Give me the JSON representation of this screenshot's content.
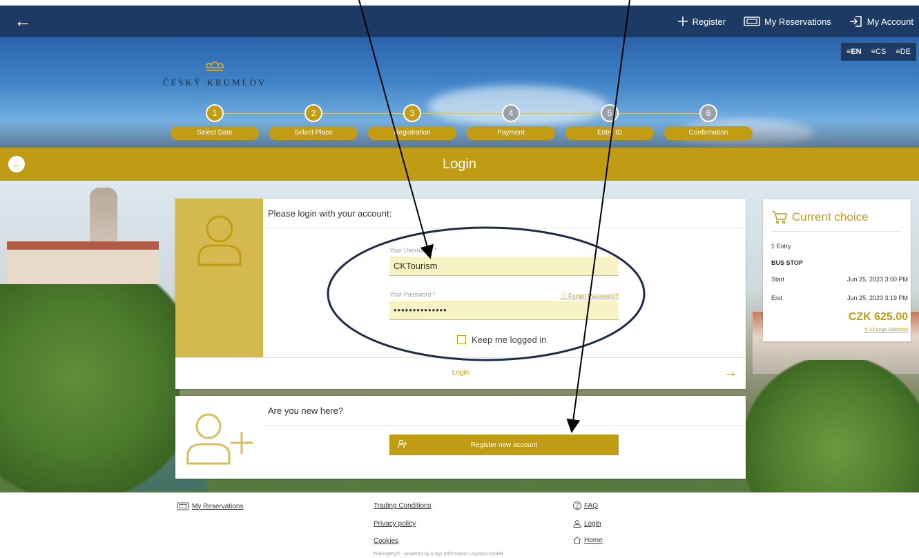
{
  "topbar": {
    "nav": [
      {
        "label": "Register",
        "icon": "plus-icon"
      },
      {
        "label": "My Reservations",
        "icon": "ticket-icon"
      },
      {
        "label": "My Account",
        "icon": "login-icon"
      }
    ]
  },
  "languages": [
    {
      "code": "EN",
      "active": true
    },
    {
      "code": "CS",
      "active": false
    },
    {
      "code": "DE",
      "active": false
    }
  ],
  "logo": {
    "text": "ČESKÝ KRUMLOV"
  },
  "steps": [
    {
      "num": "1",
      "label": "Select Date",
      "state": "done"
    },
    {
      "num": "2",
      "label": "Select Place",
      "state": "done"
    },
    {
      "num": "3",
      "label": "Registration",
      "state": "current"
    },
    {
      "num": "4",
      "label": "Payment",
      "state": "future"
    },
    {
      "num": "5",
      "label": "Entry ID",
      "state": "future"
    },
    {
      "num": "6",
      "label": "Confirmation",
      "state": "future"
    }
  ],
  "page_title": "Login",
  "login": {
    "heading": "Please login with your account:",
    "username_label": "Your Username *",
    "username_value": "CKTourism",
    "password_label": "Your Password *",
    "password_value": "••••••••••••••",
    "forgot_label": "Forgot Password?",
    "keep_logged_label": "Keep me logged in",
    "login_button": "Login"
  },
  "register": {
    "heading": "Are you new here?",
    "button": "Register new account"
  },
  "choice": {
    "title": "Current choice",
    "entry": "1 Entry",
    "place": "BUS STOP",
    "start_label": "Start",
    "start_value": "Jun 25, 2023 3:00 PM",
    "end_label": "End",
    "end_value": "Jun 25, 2023 3:19 PM",
    "price": "CZK 625.00",
    "change_label": "Change Selection"
  },
  "footer": {
    "my_reservations": "My Reservations",
    "trading_conditions": "Trading Conditions",
    "privacy_policy": "Privacy policy",
    "cookies": "Cookies",
    "faq": "FAQ",
    "login": "Login",
    "home": "Home",
    "powered": "ParkingHQ® - powered by iLogs Information Logistics GmbH"
  },
  "colors": {
    "navy": "#1d3a64",
    "gold": "#c09c14",
    "field_bg": "#f7f3c4"
  }
}
